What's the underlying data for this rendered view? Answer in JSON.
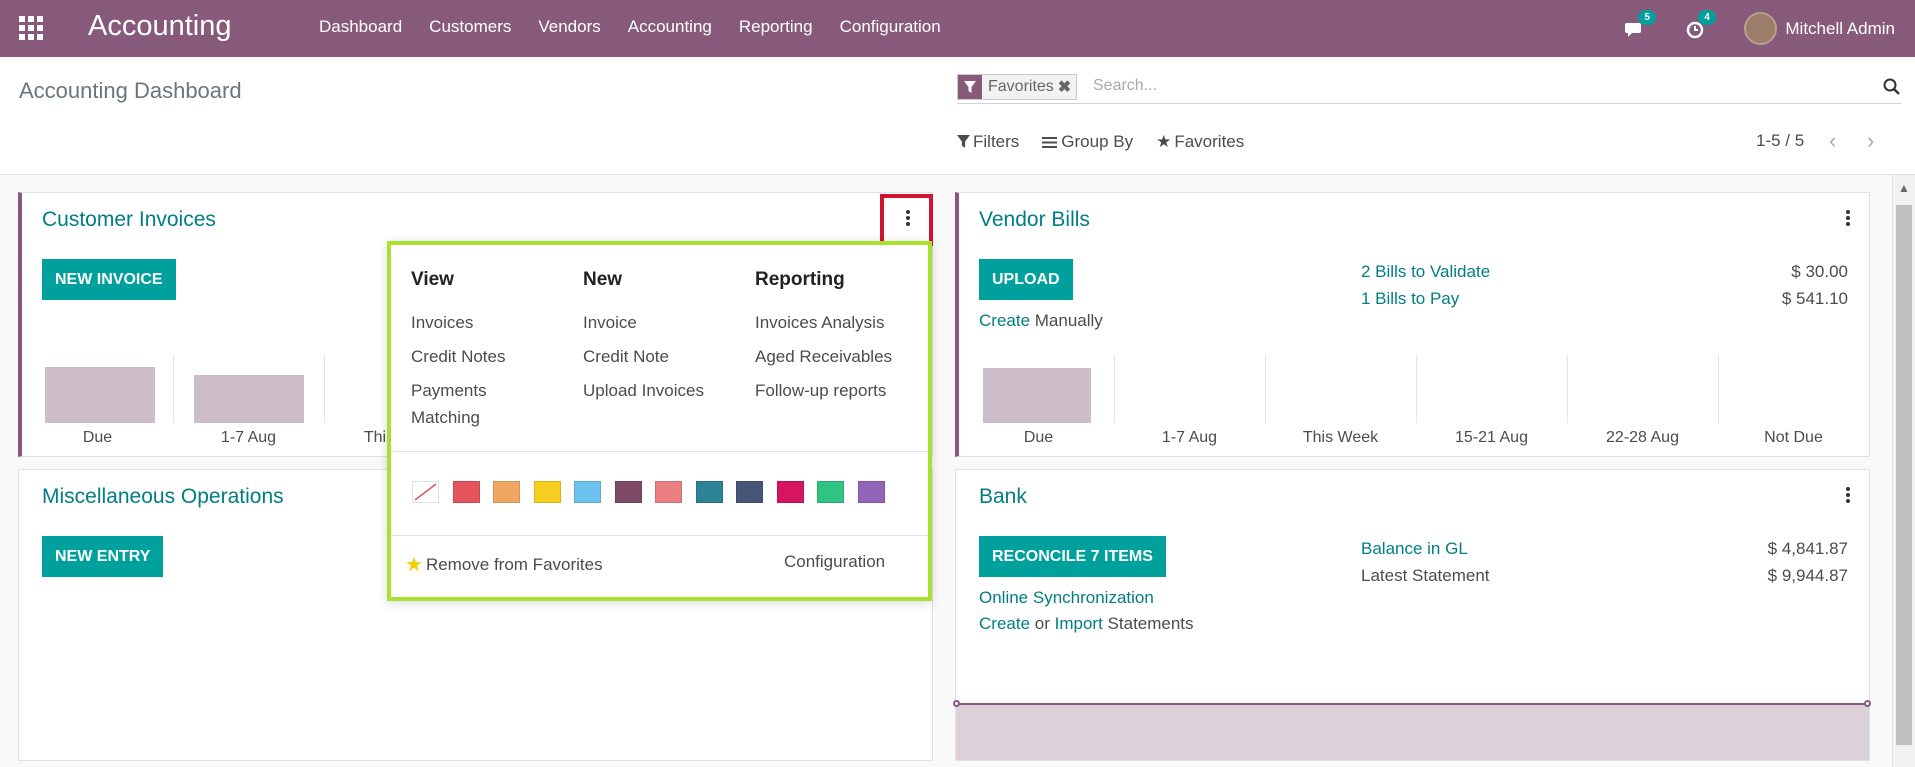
{
  "topbar": {
    "app_name": "Accounting",
    "menu": [
      "Dashboard",
      "Customers",
      "Vendors",
      "Accounting",
      "Reporting",
      "Configuration"
    ],
    "messages_count": "5",
    "activities_count": "4",
    "user_name": "Mitchell Admin",
    "bg_color": "#875a7b"
  },
  "control_panel": {
    "breadcrumb": "Accounting Dashboard",
    "facet_label": "Favorites",
    "search_placeholder": "Search...",
    "filters_label": "Filters",
    "groupby_label": "Group By",
    "favorites_label": "Favorites",
    "pager": "1-5 / 5"
  },
  "customer_invoices": {
    "title": "Customer Invoices",
    "button": "NEW INVOICE",
    "x_labels": [
      "Due",
      "1-7 Aug",
      "This"
    ]
  },
  "vendor_bills": {
    "title": "Vendor Bills",
    "button": "UPLOAD",
    "create_link": "Create",
    "create_suffix": "Manually",
    "rows": [
      {
        "label": "2 Bills to Validate",
        "amount": "$ 30.00"
      },
      {
        "label": "1 Bills to Pay",
        "amount": "$ 541.10"
      }
    ],
    "x_labels": [
      "Due",
      "1-7 Aug",
      "This Week",
      "15-21 Aug",
      "22-28 Aug",
      "Not Due"
    ]
  },
  "misc_operations": {
    "title": "Miscellaneous Operations",
    "button": "NEW ENTRY"
  },
  "bank": {
    "title": "Bank",
    "button": "RECONCILE 7 ITEMS",
    "rows": [
      {
        "label": "Balance in GL",
        "amount": "$ 4,841.87"
      },
      {
        "label": "Latest Statement",
        "amount": "$ 9,944.87"
      }
    ],
    "online_sync": "Online Synchronization",
    "create": "Create",
    "or": "or",
    "import": "Import",
    "statements": "Statements"
  },
  "dropdown": {
    "view_title": "View",
    "view_items": [
      "Invoices",
      "Credit Notes",
      "Payments",
      "Matching"
    ],
    "new_title": "New",
    "new_items": [
      "Invoice",
      "Credit Note",
      "Upload Invoices"
    ],
    "reporting_title": "Reporting",
    "reporting_items": [
      "Invoices Analysis",
      "Aged Receivables",
      "Follow-up reports"
    ],
    "colors": [
      "#ffffff",
      "#e4545c",
      "#f0a661",
      "#f7cd1f",
      "#6cc1ed",
      "#814968",
      "#eb7e7f",
      "#2c8397",
      "#475577",
      "#d6145f",
      "#30c381",
      "#9365b8"
    ],
    "remove_favorites": "Remove from Favorites",
    "configuration": "Configuration"
  }
}
